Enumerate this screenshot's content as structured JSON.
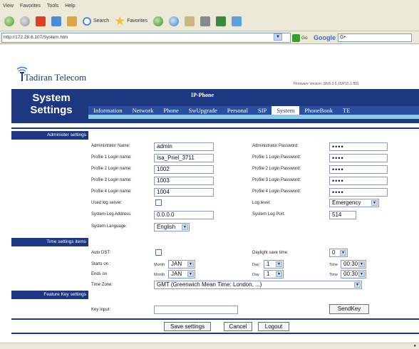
{
  "browser": {
    "menu": [
      "View",
      "Favorites",
      "Tools",
      "Help"
    ],
    "toolbar": {
      "search": "Search",
      "favorites": "Favorites"
    },
    "address": "http://172.28.6.107/System.htm",
    "go": "Go",
    "google": "Google",
    "google_field": "G•"
  },
  "brand": {
    "name": "Tadiran Telecom"
  },
  "firmware": "Firmware Version: SNS-3.5.15/P15.1 BIS",
  "header": {
    "title_line1": "System",
    "title_line2": "Settings",
    "product": "IP-Phone",
    "tabs": [
      "Information",
      "Network",
      "Phone",
      "SwUpgrade",
      "Personal",
      "SIP",
      "System",
      "PhoneBook",
      "TE"
    ]
  },
  "sections": {
    "admin": "Administer settings",
    "time": "Time settings items",
    "feature": "Feature Key settings"
  },
  "admin": {
    "admin_name_label": "Administrator Name:",
    "admin_name": "admin",
    "admin_pw_label": "Administrator Password:",
    "p1_label": "Profile 1 Login name:",
    "p1": "Isa_Priel_3711",
    "p1_pw_label": "Profile 1 Login Password:",
    "p2_label": "Profile 2 Login name:",
    "p2": "1002",
    "p2_pw_label": "Profile 2 Login Password:",
    "p3_label": "Profile 3 Login name:",
    "p3": "1003",
    "p3_pw_label": "Profile 3 Login Password:",
    "p4_label": "Profile 4 Login name:",
    "p4": "1004",
    "p4_pw_label": "Profile 4 Login Password:",
    "password_mask": "••••",
    "used_log_label": "Used log server:",
    "log_level_label": "Log level:",
    "log_level": "Emergency",
    "syslog_addr_label": "System Log Address:",
    "syslog_addr": "0.0.0.0",
    "syslog_port_label": "System Log Port:",
    "syslog_port": "514",
    "lang_label": "System Language:",
    "lang": "English"
  },
  "time": {
    "auto_dst_label": "Auto DST:",
    "dst_time_label": "Daylight save time:",
    "dst_time": "0",
    "starts_label": "Starts on :",
    "ends_label": "Ends on",
    "month_label": "Month",
    "day_label": "Day",
    "time_label": "Time",
    "start_month": "JAN",
    "start_day": "1",
    "start_time": "00:30",
    "end_month": "JAN",
    "end_day": "1",
    "end_time": "00:30",
    "tz_label": "Time Zone:",
    "tz": "GMT (Greenwich Mean Time: London, ...)"
  },
  "feature": {
    "key_input_label": "Key Input:",
    "key_input": "",
    "send_key": "SendKey"
  },
  "actions": {
    "save": "Save settings",
    "cancel": "Cancel",
    "logout": "Logout"
  }
}
